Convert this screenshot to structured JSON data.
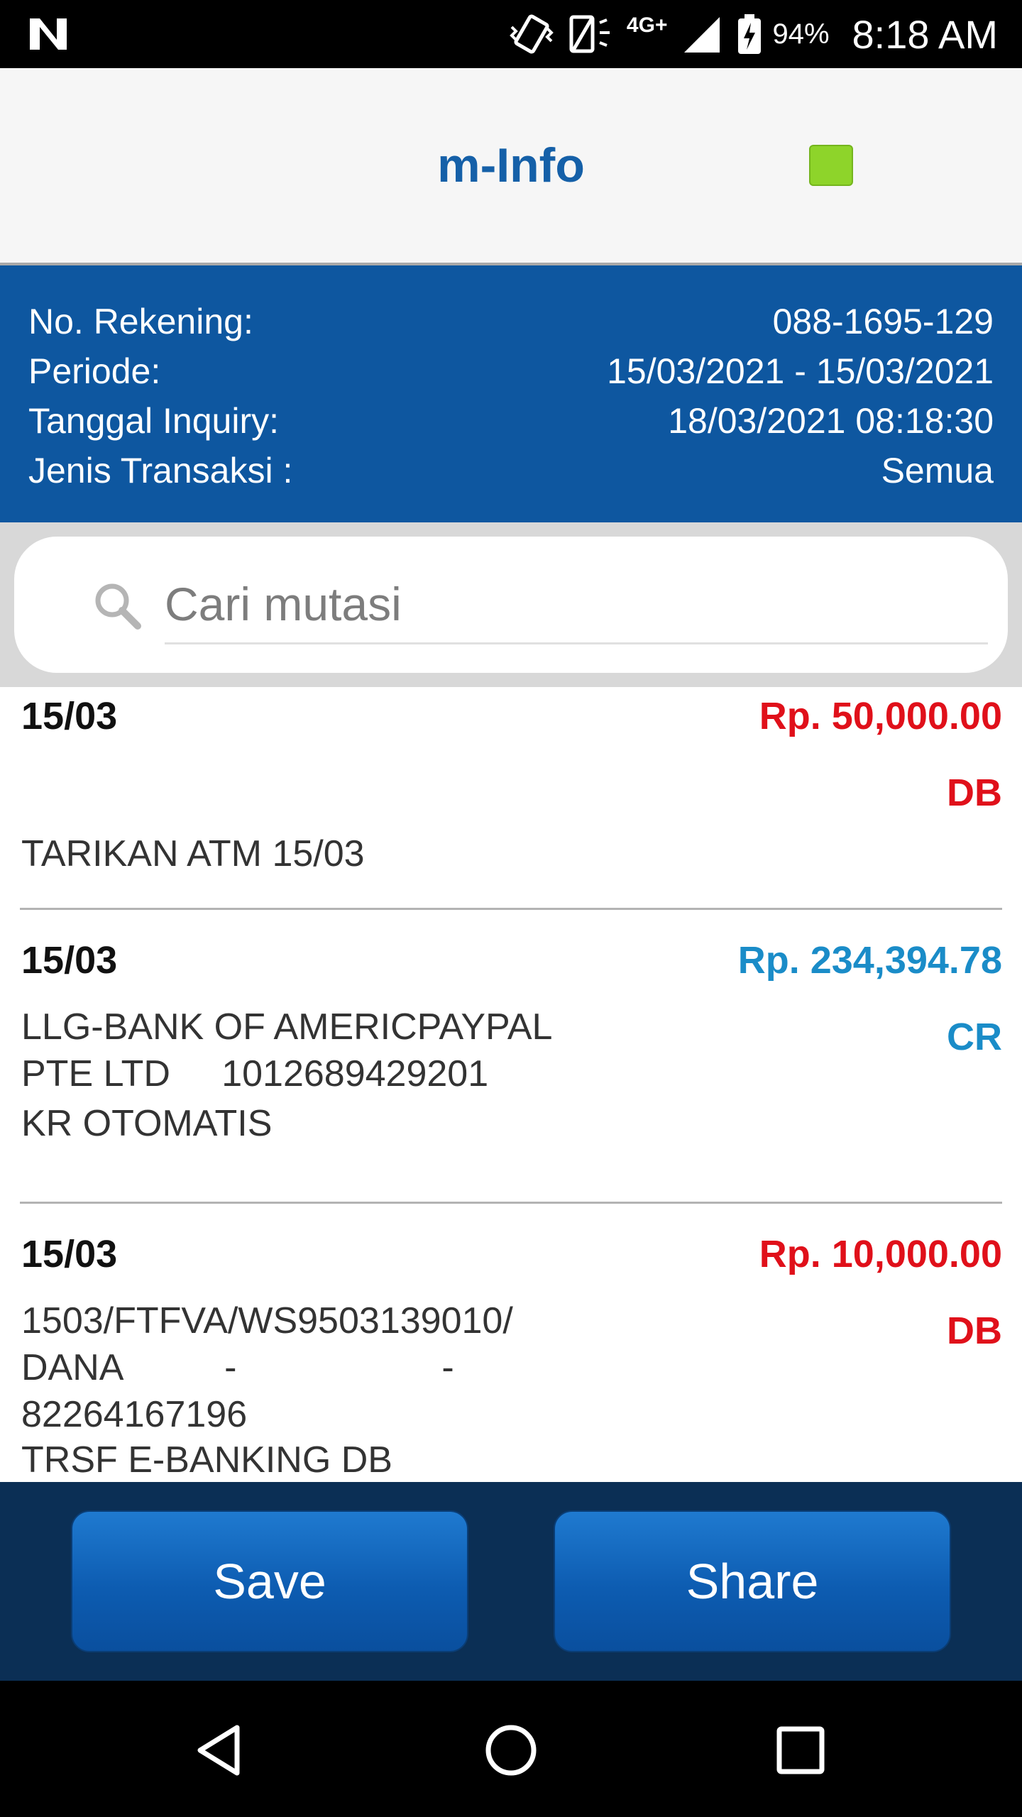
{
  "status_bar": {
    "network": "4G+",
    "battery": "94%",
    "time": "8:18 AM"
  },
  "header": {
    "title": "m-Info"
  },
  "account_info": {
    "rows": [
      {
        "label": "No. Rekening:",
        "value": "088-1695-129"
      },
      {
        "label": "Periode:",
        "value": "15/03/2021 - 15/03/2021"
      },
      {
        "label": "Tanggal Inquiry:",
        "value": "18/03/2021 08:18:30"
      },
      {
        "label": "Jenis Transaksi :",
        "value": "Semua"
      }
    ]
  },
  "search": {
    "placeholder": "Cari mutasi"
  },
  "transactions": [
    {
      "date": "15/03",
      "amount": "Rp. 50,000.00",
      "type": "DB",
      "desc_lines": [
        "TARIKAN ATM 15/03"
      ],
      "note": ""
    },
    {
      "date": "15/03",
      "amount": "Rp. 234,394.78",
      "type": "CR",
      "desc_lines": [
        "LLG-BANK OF AMERICPAYPAL",
        "PTE LTD     1012689429201"
      ],
      "note": "KR OTOMATIS"
    },
    {
      "date": "15/03",
      "amount": "Rp. 10,000.00",
      "type": "DB",
      "desc_lines": [
        "1503/FTFVA/WS9503139010/",
        "DANA          -                    -",
        "82264167196"
      ],
      "note": "TRSF E-BANKING DB"
    }
  ],
  "actions": {
    "save_label": "Save",
    "share_label": "Share"
  },
  "colors": {
    "brand_blue": "#0e57a0",
    "debit_red": "#e0101a",
    "credit_blue": "#1a8cc8",
    "status_green": "#8ed42a"
  }
}
